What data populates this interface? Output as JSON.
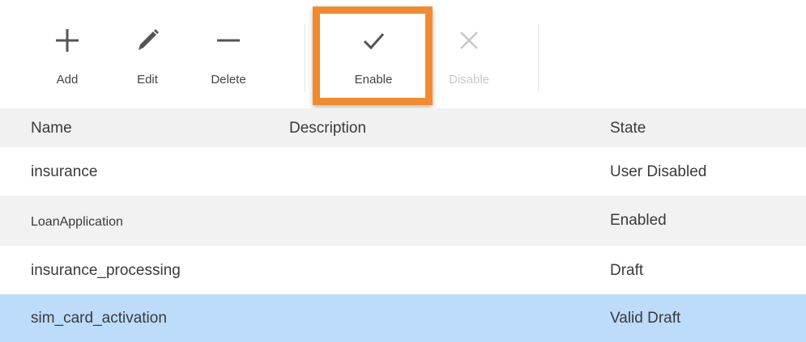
{
  "toolbar": {
    "add_label": "Add",
    "edit_label": "Edit",
    "delete_label": "Delete",
    "enable_label": "Enable",
    "disable_label": "Disable",
    "icons": {
      "add": "plus-icon",
      "edit": "pencil-icon",
      "delete": "minus-icon",
      "enable": "check-icon",
      "disable": "x-icon"
    }
  },
  "colors": {
    "highlight": "#f28b30",
    "selected_row": "#bcdcfa",
    "header_bg": "#f1f1f1"
  },
  "table": {
    "columns": {
      "name": "Name",
      "description": "Description",
      "state": "State"
    },
    "rows": [
      {
        "name": "insurance",
        "description": "",
        "state": "User Disabled"
      },
      {
        "name": "LoanApplication",
        "description": "",
        "state": "Enabled"
      },
      {
        "name": "insurance_processing",
        "description": "",
        "state": "Draft"
      },
      {
        "name": "sim_card_activation",
        "description": "",
        "state": "Valid Draft",
        "selected": true
      }
    ]
  }
}
